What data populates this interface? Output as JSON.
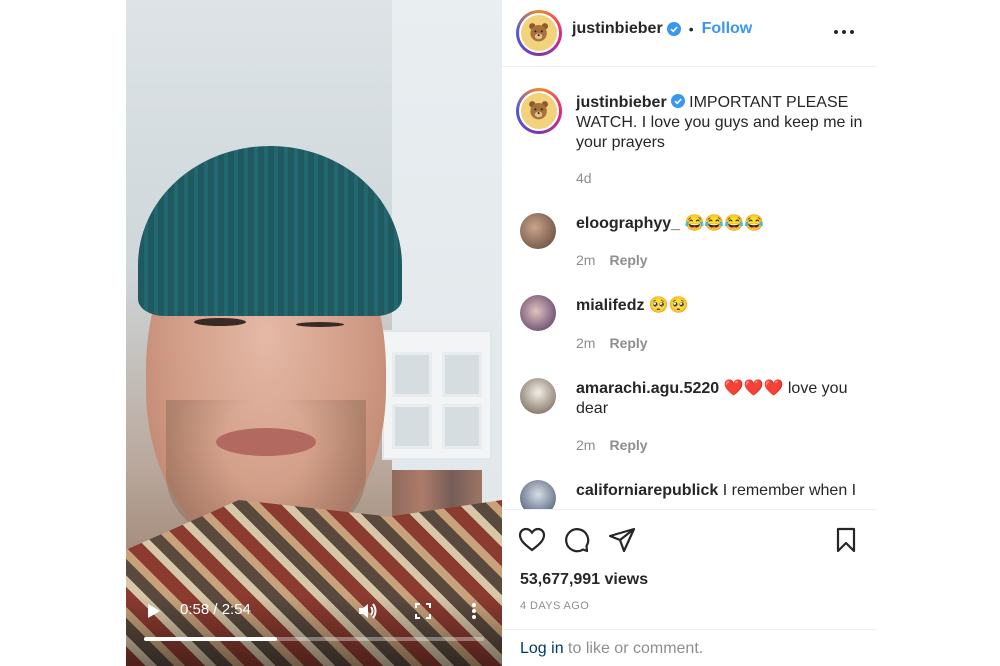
{
  "video": {
    "current_time": "0:58 / 2:54",
    "progress_fraction": 0.39
  },
  "header": {
    "username": "justinbieber",
    "separator": "•",
    "follow_label": "Follow"
  },
  "caption": {
    "username": "justinbieber",
    "text": "IMPORTANT PLEASE WATCH. I love you guys and keep me in your prayers",
    "age": "4d"
  },
  "comments": [
    {
      "username": "eloographyy_",
      "text": "😂😂😂😂",
      "age": "2m",
      "reply_label": "Reply"
    },
    {
      "username": "mialifedz",
      "text": "🥺🥺",
      "age": "2m",
      "reply_label": "Reply"
    },
    {
      "username": "amarachi.agu.5220",
      "text": "❤️❤️❤️ love you dear",
      "age": "2m",
      "reply_label": "Reply"
    },
    {
      "username": "californiarepublick",
      "text": "I remember when I",
      "age": "",
      "reply_label": ""
    }
  ],
  "stats": {
    "views": "53,677,991 views",
    "posted": "4 DAYS AGO"
  },
  "footer": {
    "login_label": "Log in",
    "rest": "to like or comment."
  },
  "colors": {
    "accent": "#3897f0",
    "verified": "#3897f0",
    "muted": "#8e8e8e"
  },
  "icons": [
    "play-icon",
    "volume-icon",
    "fullscreen-icon",
    "more-vertical-icon",
    "verified-icon",
    "more-horizontal-icon",
    "heart-icon",
    "comment-icon",
    "share-icon",
    "bookmark-icon"
  ]
}
